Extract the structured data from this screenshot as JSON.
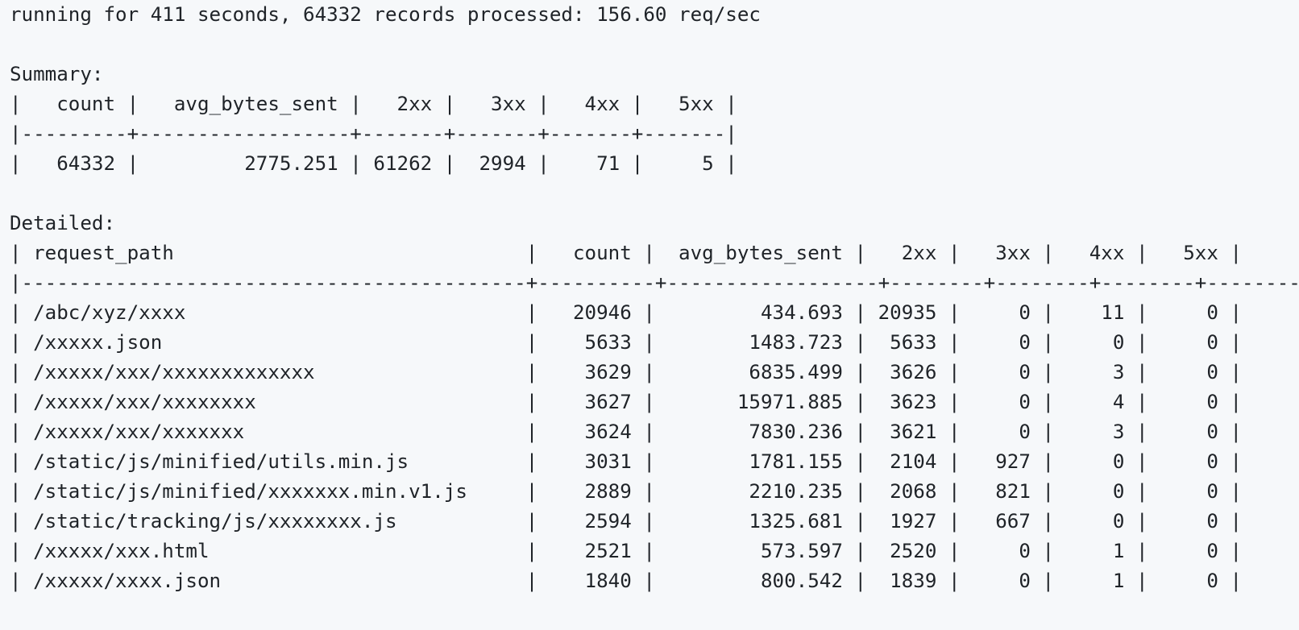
{
  "output": {
    "status_line": "running for 411 seconds, 64332 records processed: 156.60 req/sec",
    "summary": {
      "heading": "Summary:",
      "columns": [
        "count",
        "avg_bytes_sent",
        "2xx",
        "3xx",
        "4xx",
        "5xx"
      ],
      "rows": [
        [
          "64332",
          "2775.251",
          "61262",
          "2994",
          "71",
          "5"
        ]
      ]
    },
    "detailed": {
      "heading": "Detailed:",
      "columns": [
        "request_path",
        "count",
        "avg_bytes_sent",
        "2xx",
        "3xx",
        "4xx",
        "5xx"
      ],
      "rows": [
        [
          "/abc/xyz/xxxx",
          "20946",
          "434.693",
          "20935",
          "0",
          "11",
          "0"
        ],
        [
          "/xxxxx.json",
          "5633",
          "1483.723",
          "5633",
          "0",
          "0",
          "0"
        ],
        [
          "/xxxxx/xxx/xxxxxxxxxxxxx",
          "3629",
          "6835.499",
          "3626",
          "0",
          "3",
          "0"
        ],
        [
          "/xxxxx/xxx/xxxxxxxx",
          "3627",
          "15971.885",
          "3623",
          "0",
          "4",
          "0"
        ],
        [
          "/xxxxx/xxx/xxxxxxx",
          "3624",
          "7830.236",
          "3621",
          "0",
          "3",
          "0"
        ],
        [
          "/static/js/minified/utils.min.js",
          "3031",
          "1781.155",
          "2104",
          "927",
          "0",
          "0"
        ],
        [
          "/static/js/minified/xxxxxxx.min.v1.js",
          "2889",
          "2210.235",
          "2068",
          "821",
          "0",
          "0"
        ],
        [
          "/static/tracking/js/xxxxxxxx.js",
          "2594",
          "1325.681",
          "1927",
          "667",
          "0",
          "0"
        ],
        [
          "/xxxxx/xxx.html",
          "2521",
          "573.597",
          "2520",
          "0",
          "1",
          "0"
        ],
        [
          "/xxxxx/xxxx.json",
          "1840",
          "800.542",
          "1839",
          "0",
          "1",
          "0"
        ]
      ]
    }
  }
}
